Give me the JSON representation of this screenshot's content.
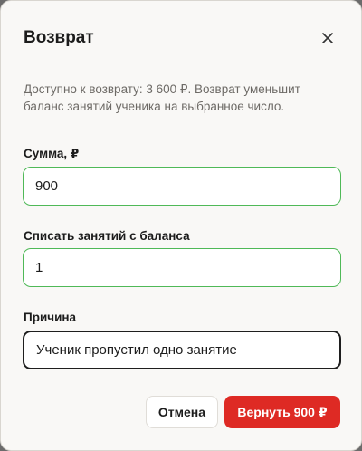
{
  "dialog": {
    "title": "Возврат",
    "close_icon": "close-icon",
    "description": "Доступно к возврату: 3 600 ₽. Возврат уменьшит баланс занятий ученика на выбранное число."
  },
  "form": {
    "amount": {
      "label": "Сумма, ₽",
      "value": "900"
    },
    "lessons": {
      "label": "Списать занятий с баланса",
      "value": "1"
    },
    "reason": {
      "label": "Причина",
      "value": "Ученик пропустил одно занятие"
    }
  },
  "actions": {
    "cancel_label": "Отмена",
    "refund_label": "Вернуть 900 ₽"
  },
  "colors": {
    "primary": "#de2a24",
    "valid_border": "#4fb957",
    "focused_border": "#1e1e1e",
    "modal_bg": "#f9f8f6"
  }
}
